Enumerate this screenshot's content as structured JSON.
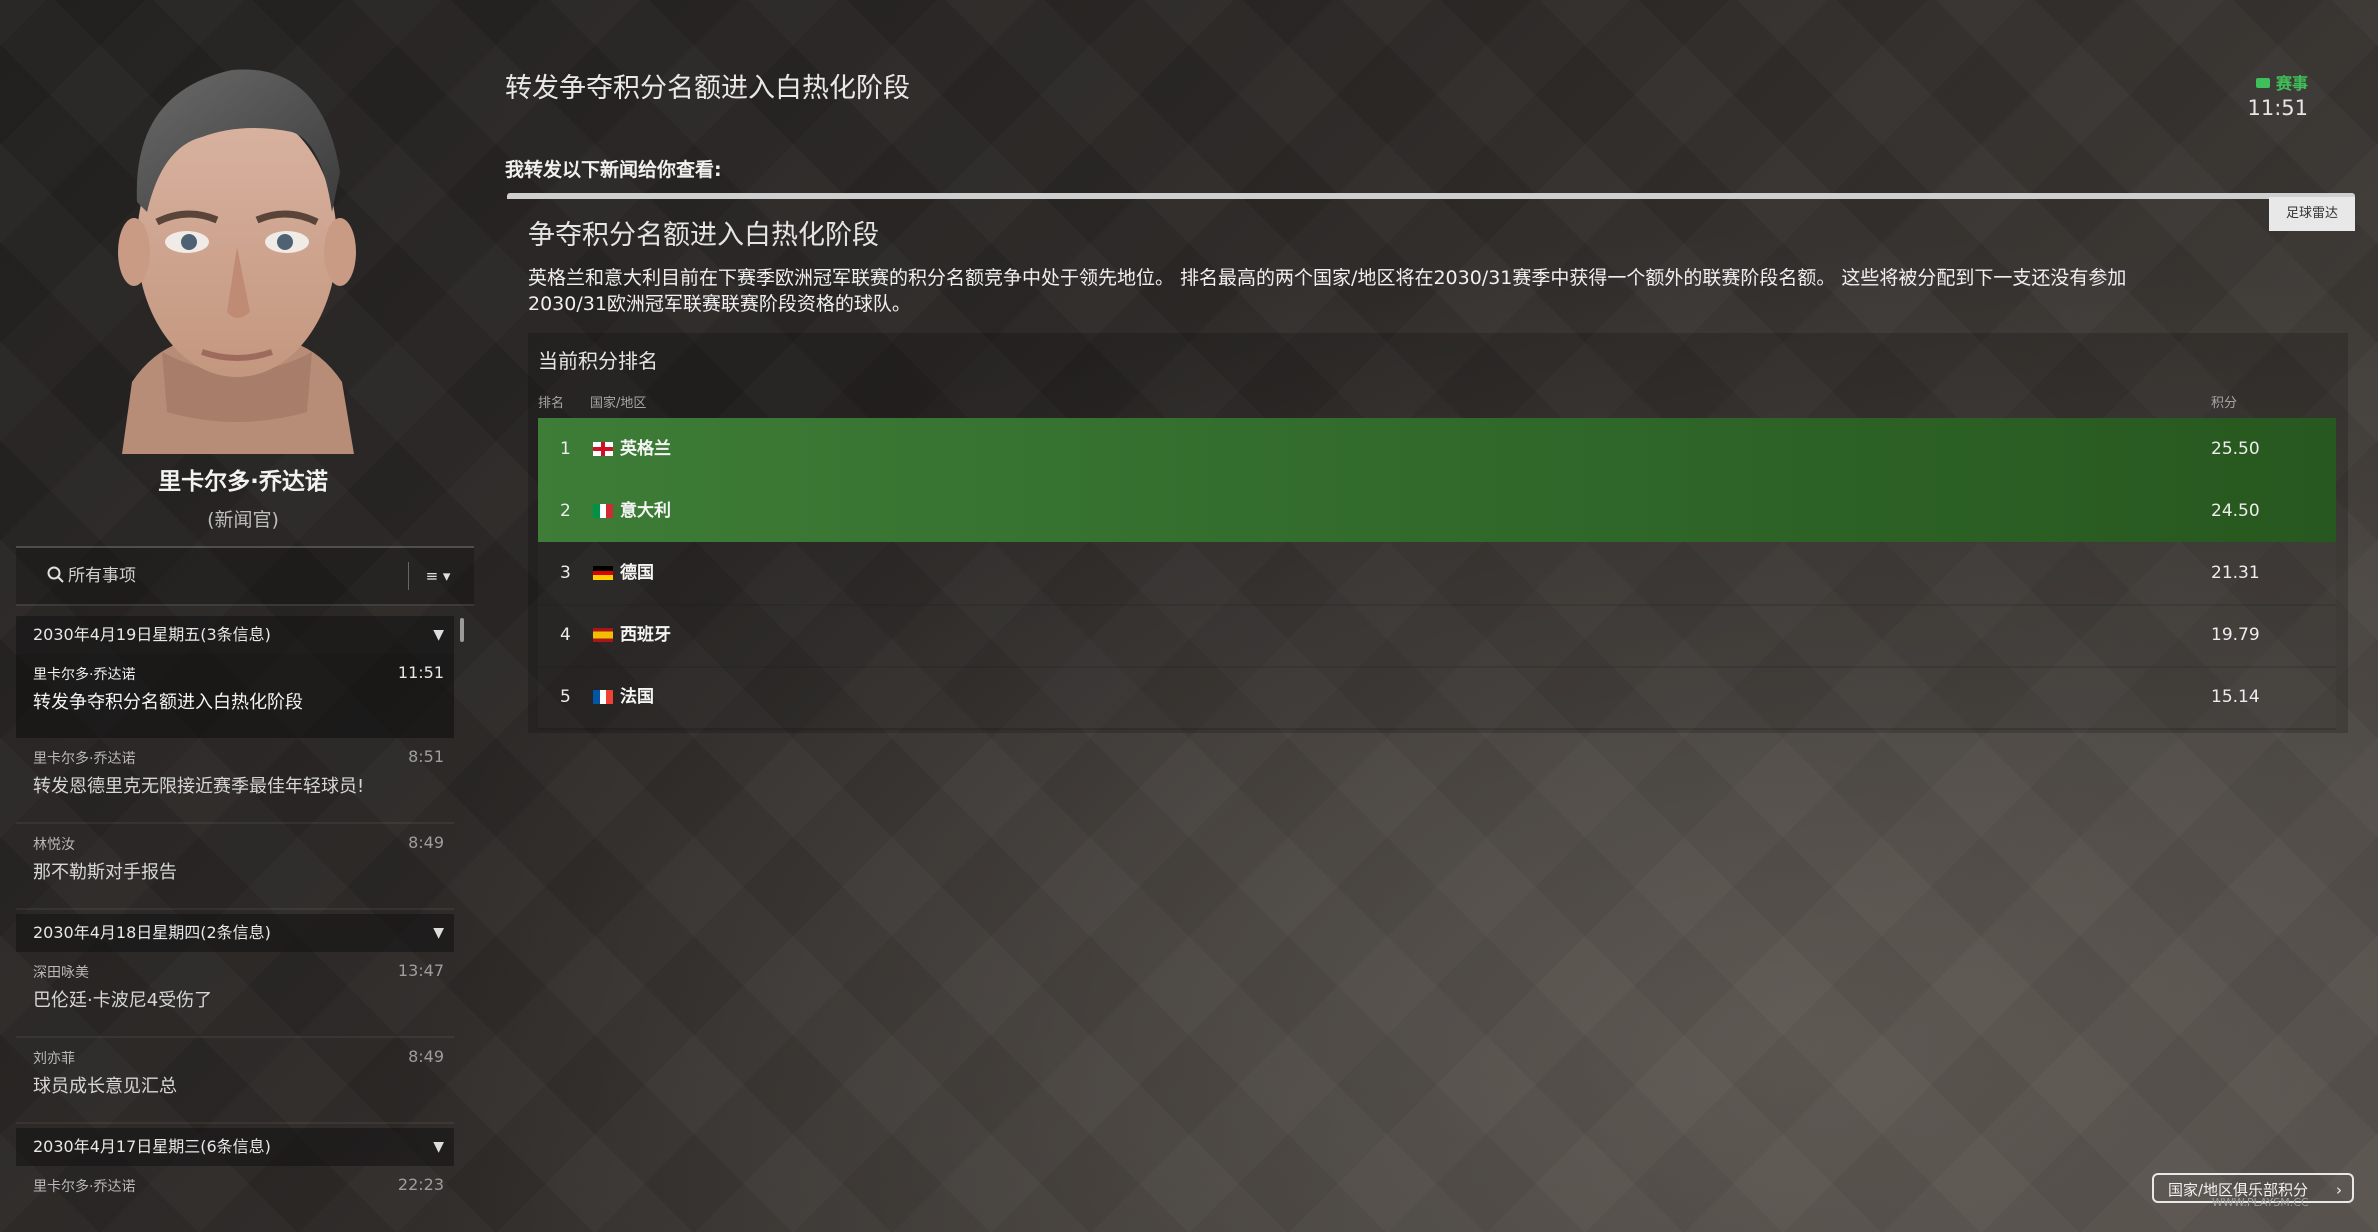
{
  "page": {
    "title": "转发争夺积分名额进入白热化阶段",
    "forward_note": "我转发以下新闻给你查看:",
    "status_tag": "赛事",
    "status_time": "11:51"
  },
  "sender": {
    "name": "里卡尔多·乔达诺",
    "role": "(新闻官)"
  },
  "search": {
    "placeholder": "所有事项",
    "filter_label": "≡ ▾"
  },
  "inbox": {
    "groups": [
      {
        "header": "2030年4月19日星期五(3条信息)",
        "messages": [
          {
            "from": "里卡尔多·乔达诺",
            "time": "11:51",
            "subject": "转发争夺积分名额进入白热化阶段"
          },
          {
            "from": "里卡尔多·乔达诺",
            "time": "8:51",
            "subject": "转发恩德里克无限接近赛季最佳年轻球员!"
          },
          {
            "from": "林悦汝",
            "time": "8:49",
            "subject": "那不勒斯对手报告"
          }
        ]
      },
      {
        "header": "2030年4月18日星期四(2条信息)",
        "messages": [
          {
            "from": "深田咏美",
            "time": "13:47",
            "subject": "巴伦廷·卡波尼4受伤了"
          },
          {
            "from": "刘亦菲",
            "time": "8:49",
            "subject": "球员成长意见汇总"
          }
        ]
      },
      {
        "header": "2030年4月17日星期三(6条信息)",
        "messages": [
          {
            "from": "里卡尔多·乔达诺",
            "time": "22:23",
            "subject": ""
          }
        ]
      }
    ]
  },
  "article": {
    "source": "足球雷达",
    "title": "争夺积分名额进入白热化阶段",
    "body": "英格兰和意大利目前在下赛季欧洲冠军联赛的积分名额竞争中处于领先地位。 排名最高的两个国家/地区将在2030/31赛季中获得一个额外的联赛阶段名额。 这些将被分配到下一支还没有参加2030/31欧洲冠军联赛联赛阶段资格的球队。"
  },
  "ranking": {
    "title": "当前积分排名",
    "headers": {
      "rank": "排名",
      "country": "国家/地区",
      "points": "积分"
    },
    "rows": [
      {
        "rank": "1",
        "country": "英格兰",
        "points": "25.50",
        "flag": "england-flag-icon"
      },
      {
        "rank": "2",
        "country": "意大利",
        "points": "24.50",
        "flag": "italy-flag-icon"
      },
      {
        "rank": "3",
        "country": "德国",
        "points": "21.31",
        "flag": "germany-flag-icon"
      },
      {
        "rank": "4",
        "country": "西班牙",
        "points": "19.79",
        "flag": "spain-flag-icon"
      },
      {
        "rank": "5",
        "country": "法国",
        "points": "15.14",
        "flag": "france-flag-icon"
      }
    ]
  },
  "footer": {
    "coefficient_button": "国家/地区俱乐部积分",
    "watermark": "WWW.PLAYSM.CC"
  },
  "colors": {
    "accent_green": "#3fbf5a",
    "highlight_row": "#3d7d37"
  }
}
